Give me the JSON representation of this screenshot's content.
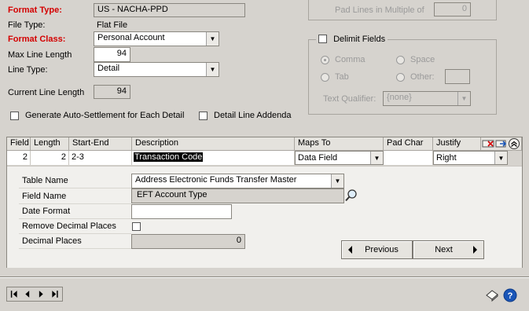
{
  "format": {
    "format_type_label": "Format Type:",
    "format_type_value": "US - NACHA-PPD",
    "file_type_label": "File Type:",
    "file_type_value": "Flat File",
    "format_class_label": "Format Class:",
    "format_class_value": "Personal Account",
    "max_line_length_label": "Max Line Length",
    "max_line_length_value": "94",
    "line_type_label": "Line Type:",
    "line_type_value": "Detail",
    "current_line_length_label": "Current Line Length",
    "current_line_length_value": "94"
  },
  "options": {
    "auto_settlement_label": "Generate Auto-Settlement for Each Detail",
    "detail_addenda_label": "Detail Line Addenda"
  },
  "pad": {
    "pad_lines_label": "Pad Lines in Multiple of",
    "pad_lines_value": "0"
  },
  "delimit": {
    "label": "Delimit Fields",
    "comma": "Comma",
    "space": "Space",
    "tab": "Tab",
    "other": "Other:",
    "text_qualifier_label": "Text Qualifier:",
    "text_qualifier_value": "{none}"
  },
  "grid": {
    "headers": {
      "field": "Field",
      "length": "Length",
      "start_end": "Start-End",
      "description": "Description",
      "maps_to": "Maps To",
      "pad_char": "Pad Char",
      "justify": "Justify"
    },
    "row": {
      "field": "2",
      "length": "2",
      "start_end": "2-3",
      "description": "Transaction Code",
      "maps_to": "Data Field",
      "pad_char": "",
      "justify": "Right"
    }
  },
  "detail": {
    "table_name_label": "Table Name",
    "table_name_value": "Address Electronic Funds Transfer Master",
    "field_name_label": "Field Name",
    "field_name_value": "EFT Account Type",
    "date_format_label": "Date Format",
    "date_format_value": "",
    "remove_decimal_label": "Remove Decimal Places",
    "decimal_places_label": "Decimal Places",
    "decimal_places_value": "0",
    "previous_label": "Previous",
    "next_label": "Next"
  },
  "icons": {
    "lookup": "magnifier-icon",
    "note": "note-icon",
    "help": "help-icon"
  },
  "colors": {
    "required_label": "#d40000",
    "background": "#d6d3ce",
    "selection": "#000000",
    "help": "#1a56b8"
  }
}
